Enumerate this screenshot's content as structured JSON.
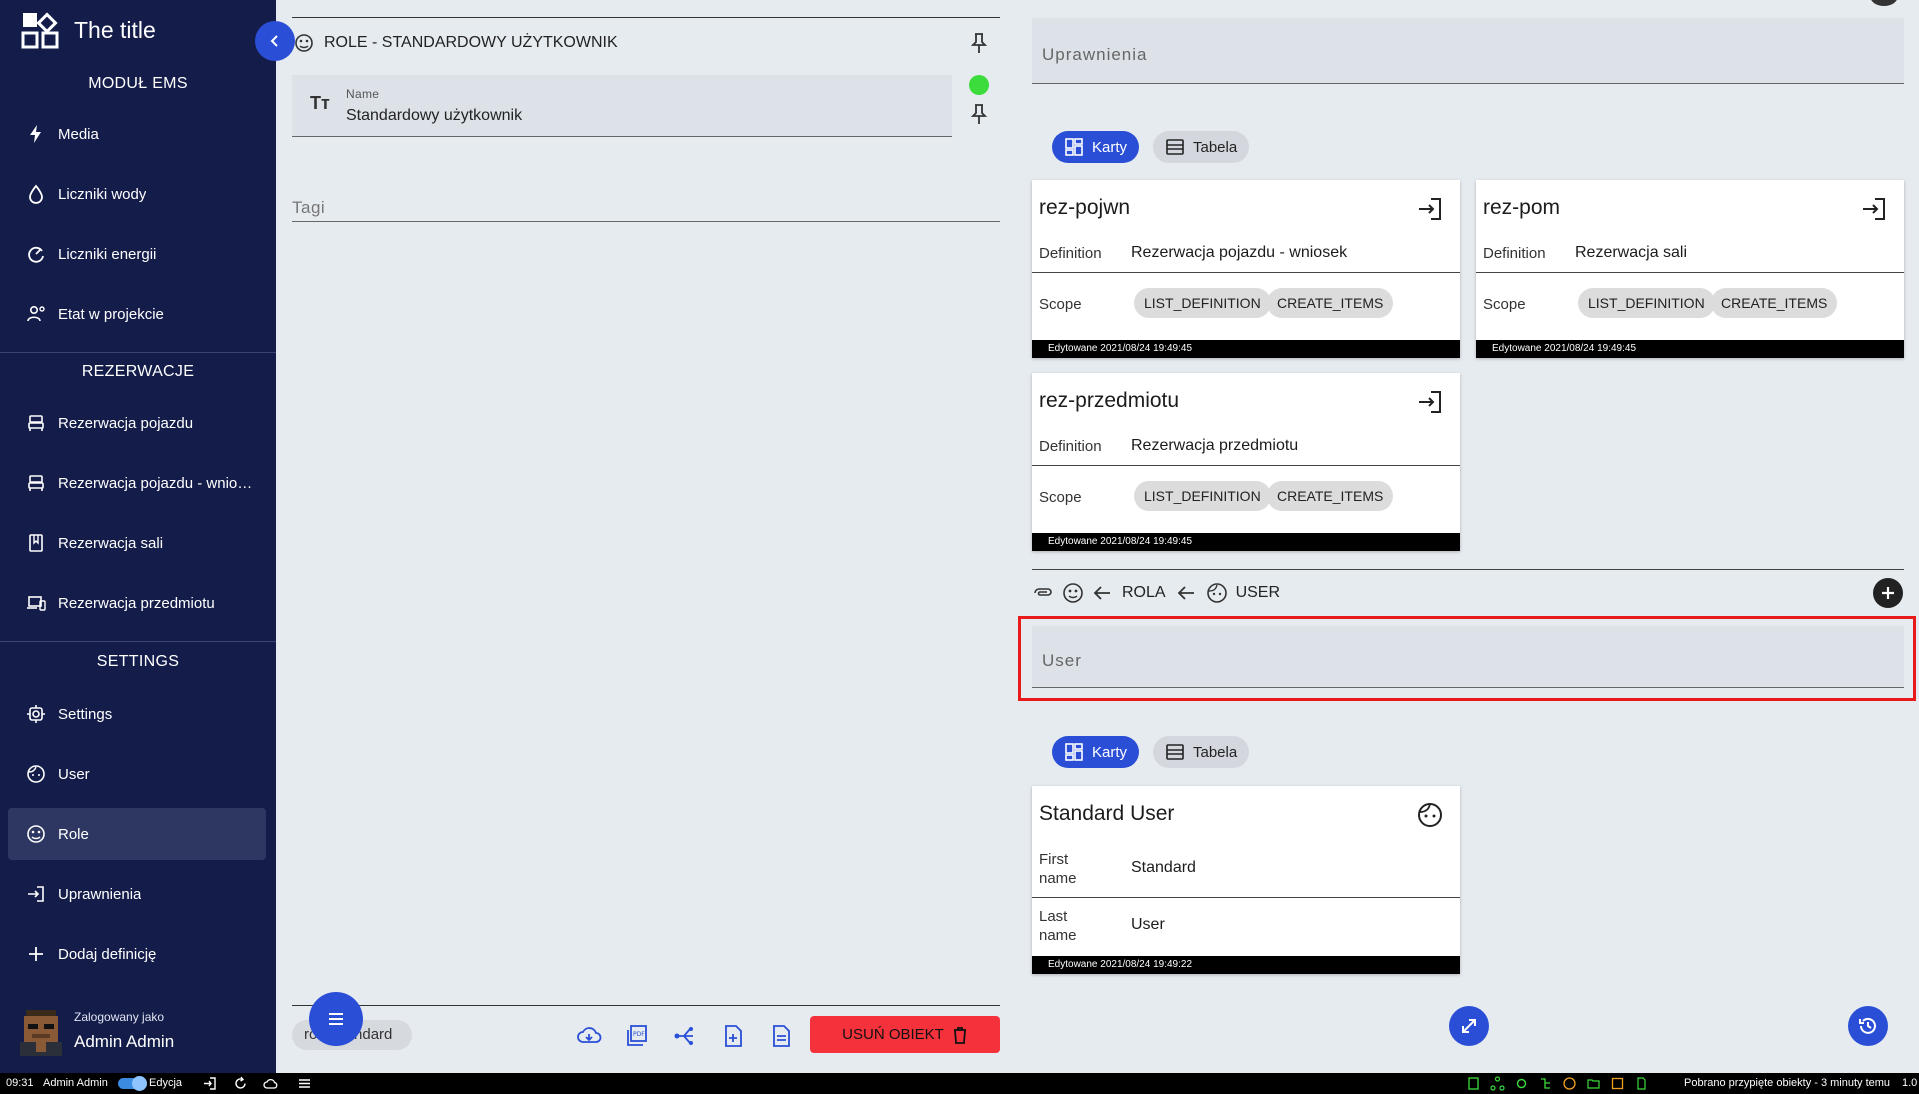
{
  "app": {
    "title": "The title"
  },
  "sidebar": {
    "sections": [
      {
        "title": "MODUŁ EMS"
      },
      {
        "title": "REZERWACJE"
      },
      {
        "title": "SETTINGS"
      }
    ],
    "items": [
      {
        "label": "Media",
        "icon": "lightning-icon"
      },
      {
        "label": "Liczniki wody",
        "icon": "water-drop-icon"
      },
      {
        "label": "Liczniki energii",
        "icon": "gauge-icon"
      },
      {
        "label": "Etat w projekcie",
        "icon": "user-settings-icon"
      },
      {
        "label": "Rezerwacja pojazdu",
        "icon": "bed-icon"
      },
      {
        "label": "Rezerwacja pojazdu - wniosek",
        "icon": "bed-icon"
      },
      {
        "label": "Rezerwacja sali",
        "icon": "book-icon"
      },
      {
        "label": "Rezerwacja przedmiotu",
        "icon": "devices-icon"
      },
      {
        "label": "Settings",
        "icon": "cog-icon"
      },
      {
        "label": "User",
        "icon": "face-icon"
      },
      {
        "label": "Role",
        "icon": "role-face-icon",
        "active": true
      },
      {
        "label": "Uprawnienia",
        "icon": "login-icon"
      },
      {
        "label": "Dodaj definicję",
        "icon": "plus-icon"
      }
    ],
    "user": {
      "logged_as": "Zalogowany jako",
      "name": "Admin Admin"
    }
  },
  "object": {
    "header": "ROLE - STANDARDOWY UŻYTKOWNIK",
    "name_label": "Name",
    "name_value": "Standardowy użytkownik",
    "tags_placeholder": "Tagi",
    "bottom_chip": "role-standard",
    "delete_label": "USUŃ OBIEKT"
  },
  "permissions": {
    "field_label": "Uprawnienia",
    "view_cards": "Karty",
    "view_table": "Tabela",
    "cards": [
      {
        "title": "rez-pojwn",
        "def_key": "Definition",
        "def_value": "Rezerwacja pojazdu - wniosek",
        "scope_key": "Scope",
        "scopes": [
          "LIST_DEFINITION",
          "CREATE_ITEMS"
        ],
        "edited": "Edytowane 2021/08/24 19:49:45"
      },
      {
        "title": "rez-pom",
        "def_key": "Definition",
        "def_value": "Rezerwacja sali",
        "scope_key": "Scope",
        "scopes": [
          "LIST_DEFINITION",
          "CREATE_ITEMS"
        ],
        "edited": "Edytowane 2021/08/24 19:49:45"
      },
      {
        "title": "rez-przedmiotu",
        "def_key": "Definition",
        "def_value": "Rezerwacja przedmiotu",
        "scope_key": "Scope",
        "scopes": [
          "LIST_DEFINITION",
          "CREATE_ITEMS"
        ],
        "edited": "Edytowane 2021/08/24 19:49:45"
      }
    ]
  },
  "relation": {
    "from_label": "ROLA",
    "to_label": "USER",
    "field_label": "User",
    "view_cards": "Karty",
    "view_table": "Tabela",
    "card": {
      "title": "Standard User",
      "first_key": "First name",
      "first_value": "Standard",
      "last_key": "Last name",
      "last_value": "User",
      "edited": "Edytowane 2021/08/24 19:49:22"
    }
  },
  "statusbar": {
    "time": "09:31",
    "user": "Admin Admin",
    "mode": "Edycja",
    "message": "Pobrano przypięte obiekty - 3 minuty temu",
    "version": "1.0"
  },
  "colors": {
    "sidebar_bg": "#141d4a",
    "accent": "#2a4fd6",
    "danger": "#f5323c",
    "highlight": "#e81a1a",
    "status_green": "#3bdc3b"
  }
}
